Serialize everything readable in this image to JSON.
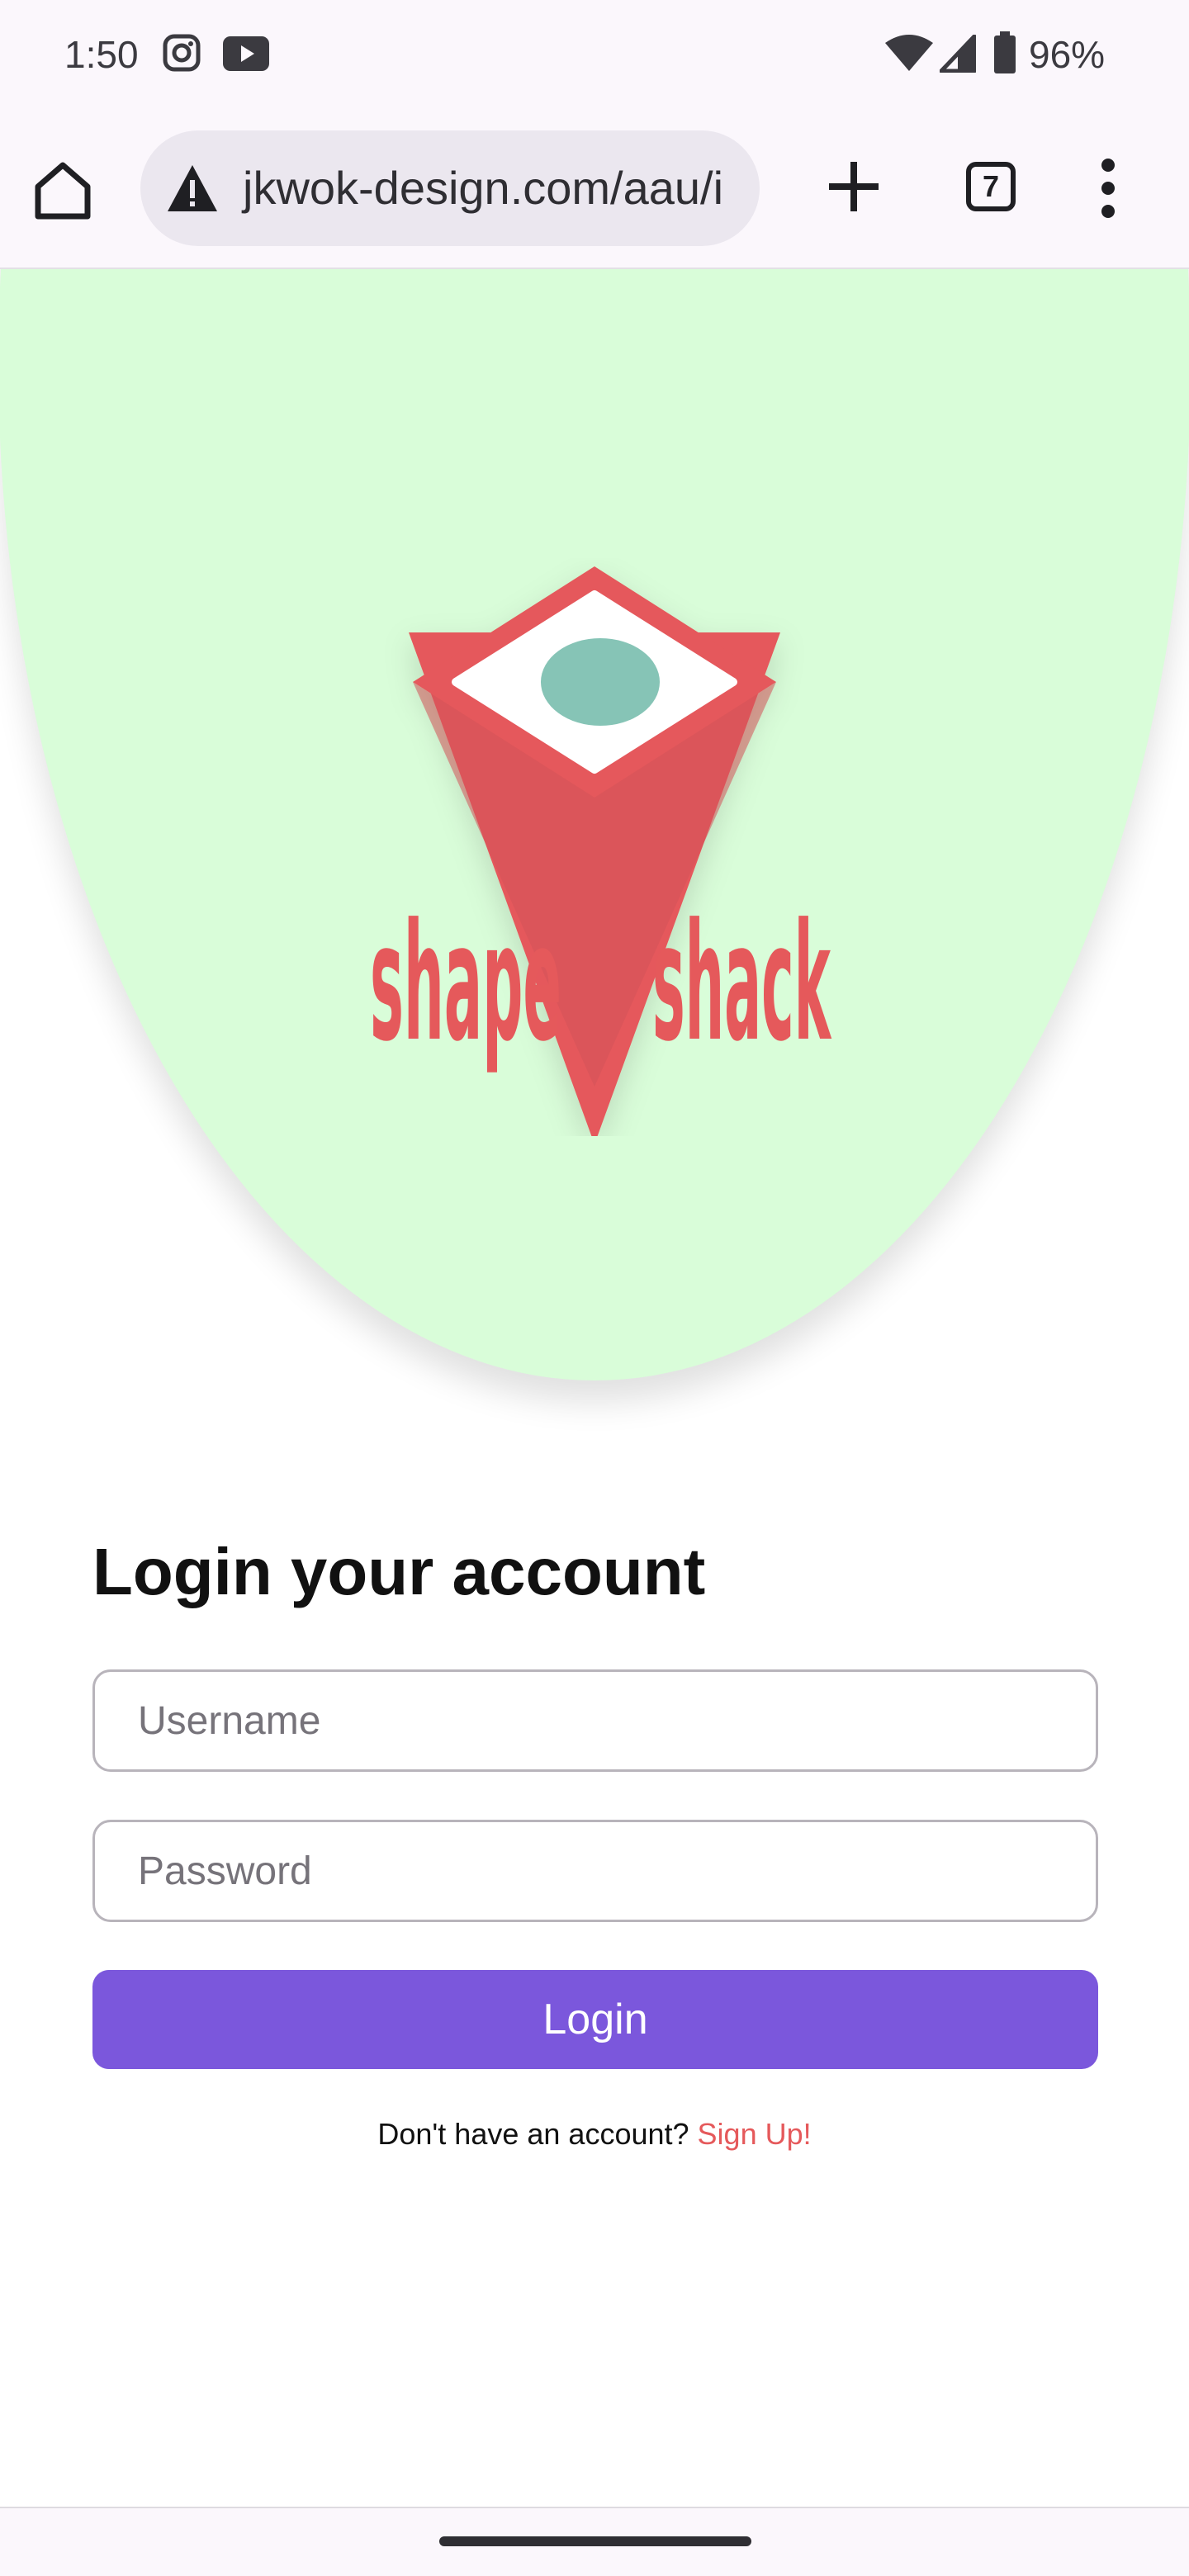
{
  "status_bar": {
    "time": "1:50",
    "battery": "96%",
    "icons": [
      "instagram-icon",
      "youtube-icon",
      "wifi-icon",
      "signal-icon",
      "battery-icon"
    ]
  },
  "browser": {
    "url": "jkwok-design.com/aau/i",
    "tab_count": "7",
    "icons": [
      "home-icon",
      "warning-icon",
      "plus-icon",
      "tabs-icon",
      "more-vert-icon"
    ]
  },
  "hero": {
    "logo_text": "shape shack",
    "background_color": "#d9fdd9",
    "logo_color": "#e5595b",
    "logo_dot_color": "#86c4b6"
  },
  "login": {
    "title": "Login your account",
    "username_placeholder": "Username",
    "password_placeholder": "Password",
    "button_label": "Login",
    "button_color": "#7b57dc",
    "signup_prompt": "Don't have an account?",
    "signup_link": "Sign Up!",
    "link_color": "#e5595b"
  }
}
